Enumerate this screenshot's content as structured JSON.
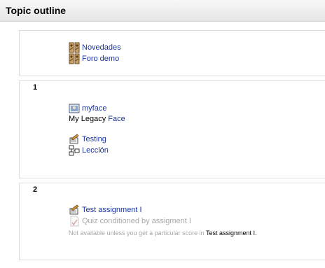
{
  "header": {
    "title": "Topic outline"
  },
  "sections": [
    {
      "number": "",
      "items": [
        {
          "label": "Novedades",
          "icon": "forum-icon"
        },
        {
          "label": "Foro demo",
          "icon": "forum-icon"
        }
      ]
    },
    {
      "number": "1",
      "items": [
        {
          "label": "myface",
          "icon": "resource-image-icon"
        },
        {
          "label": "Testing",
          "icon": "assignment-icon"
        },
        {
          "label": "Lección",
          "icon": "lesson-icon"
        }
      ],
      "label_text": {
        "prefix": "My Legacy ",
        "link": "Face"
      }
    },
    {
      "number": "2",
      "items": [
        {
          "label": "Test assignment I",
          "icon": "assignment-icon"
        },
        {
          "label": "Quiz conditioned by assigment I",
          "icon": "quiz-icon",
          "dimmed": true
        }
      ],
      "availability": {
        "text": "Not available unless you get a particular score in ",
        "ref": "Test assignment I",
        "suffix": "."
      }
    }
  ],
  "colors": {
    "link": "#1a35a0",
    "dimmed": "#a8a8a8",
    "header_bg": "#ececec"
  }
}
